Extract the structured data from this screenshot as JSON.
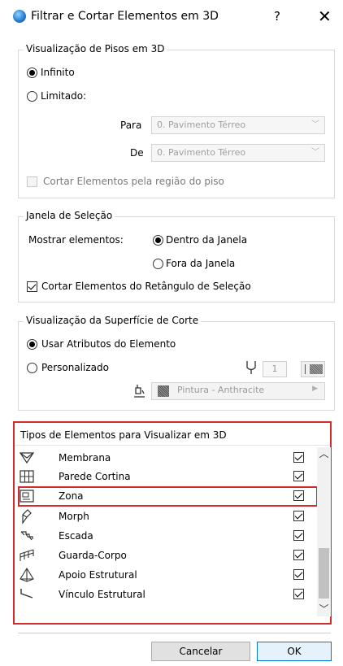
{
  "window": {
    "title": "Filtrar e Cortar Elementos em 3D",
    "help": "?",
    "close": "✕"
  },
  "floors": {
    "legend": "Visualização de Pisos em 3D",
    "infinite_label": "Infinito",
    "limited_label": "Limitado:",
    "para_label": "Para",
    "para_value": "0. Pavimento Térreo",
    "de_label": "De",
    "de_value": "0. Pavimento Térreo",
    "cut_label": "Cortar Elementos pela região do piso"
  },
  "selection": {
    "legend": "Janela de Seleção",
    "show_label": "Mostrar elementos:",
    "inside_label": "Dentro da Janela",
    "outside_label": "Fora da Janela",
    "cut_label": "Cortar Elementos do Retângulo de Seleção"
  },
  "surface": {
    "legend": "Visualização da Superfície de Corte",
    "use_attr_label": "Usar Atributos do Elemento",
    "custom_label": "Personalizado",
    "pen_number": "1",
    "paint_label": "Pintura - Anthracite"
  },
  "types": {
    "legend": "Tipos de Elementos para Visualizar em 3D",
    "items": [
      {
        "name": "Membrana",
        "icon": "membrane-icon",
        "checked": true
      },
      {
        "name": "Parede Cortina",
        "icon": "curtain-wall-icon",
        "checked": true
      },
      {
        "name": "Zona",
        "icon": "zone-icon",
        "checked": true
      },
      {
        "name": "Morph",
        "icon": "morph-icon",
        "checked": true
      },
      {
        "name": "Escada",
        "icon": "stair-icon",
        "checked": true
      },
      {
        "name": "Guarda-Corpo",
        "icon": "railing-icon",
        "checked": true
      },
      {
        "name": "Apoio Estrutural",
        "icon": "structural-support-icon",
        "checked": true
      },
      {
        "name": "Vínculo Estrutural",
        "icon": "structural-link-icon",
        "checked": true
      }
    ]
  },
  "buttons": {
    "cancel": "Cancelar",
    "ok": "OK"
  },
  "colors": {
    "highlight_red": "#d12b2b",
    "ok_border": "#0078d7"
  }
}
